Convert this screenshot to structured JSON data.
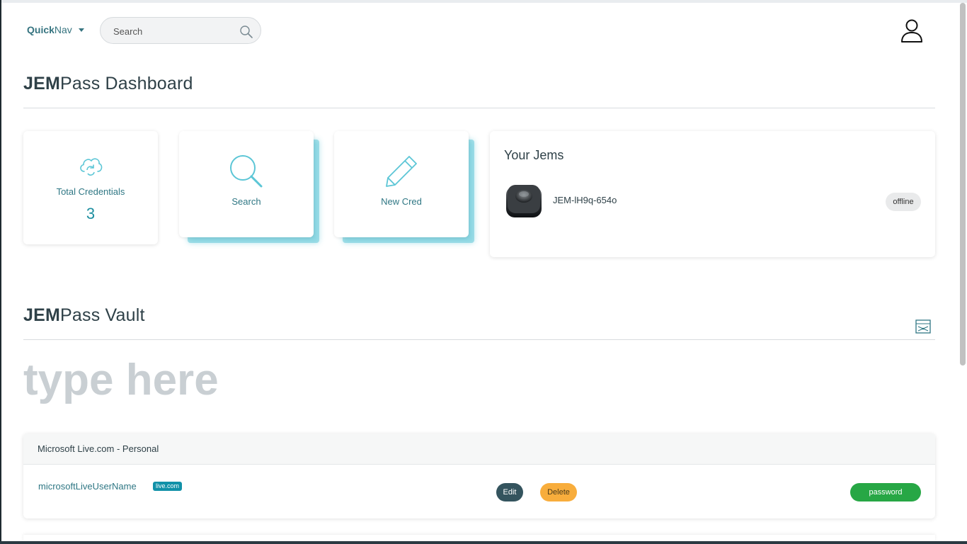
{
  "nav": {
    "quicknav_bold": "Quick",
    "quicknav_rest": "Nav",
    "search_placeholder": "Search"
  },
  "dashboard": {
    "title_bold": "JEM",
    "title_rest": "Pass Dashboard",
    "stat": {
      "label": "Total Credentials",
      "value": "3"
    },
    "search_card_label": "Search",
    "newcred_card_label": "New Cred",
    "jems": {
      "title": "Your Jems",
      "devices": [
        {
          "name": "JEM-lH9q-654o",
          "status": "offline"
        }
      ]
    }
  },
  "vault": {
    "title_bold": "JEM",
    "title_rest": "Pass Vault",
    "filter_placeholder": "type here",
    "credentials": [
      {
        "name": "Microsoft Live.com - Personal",
        "username": "microsoftLiveUserName",
        "tag": "live.com",
        "edit_label": "Edit",
        "delete_label": "Delete",
        "password_label": "password"
      }
    ]
  },
  "colors": {
    "accent": "#2f7784",
    "teal_value": "#1d8fa0",
    "icon_teal": "#5cc6d6",
    "edit": "#34545e",
    "delete": "#f8ad3c",
    "password": "#27a745",
    "tag": "#1191a8"
  },
  "icons": {
    "search": "search-icon",
    "user": "user-icon",
    "cloud": "cloud-sync-icon",
    "magnifier": "magnifier-icon",
    "pencil": "pencil-icon",
    "device": "jem-device-image",
    "expand": "expand-icon"
  }
}
